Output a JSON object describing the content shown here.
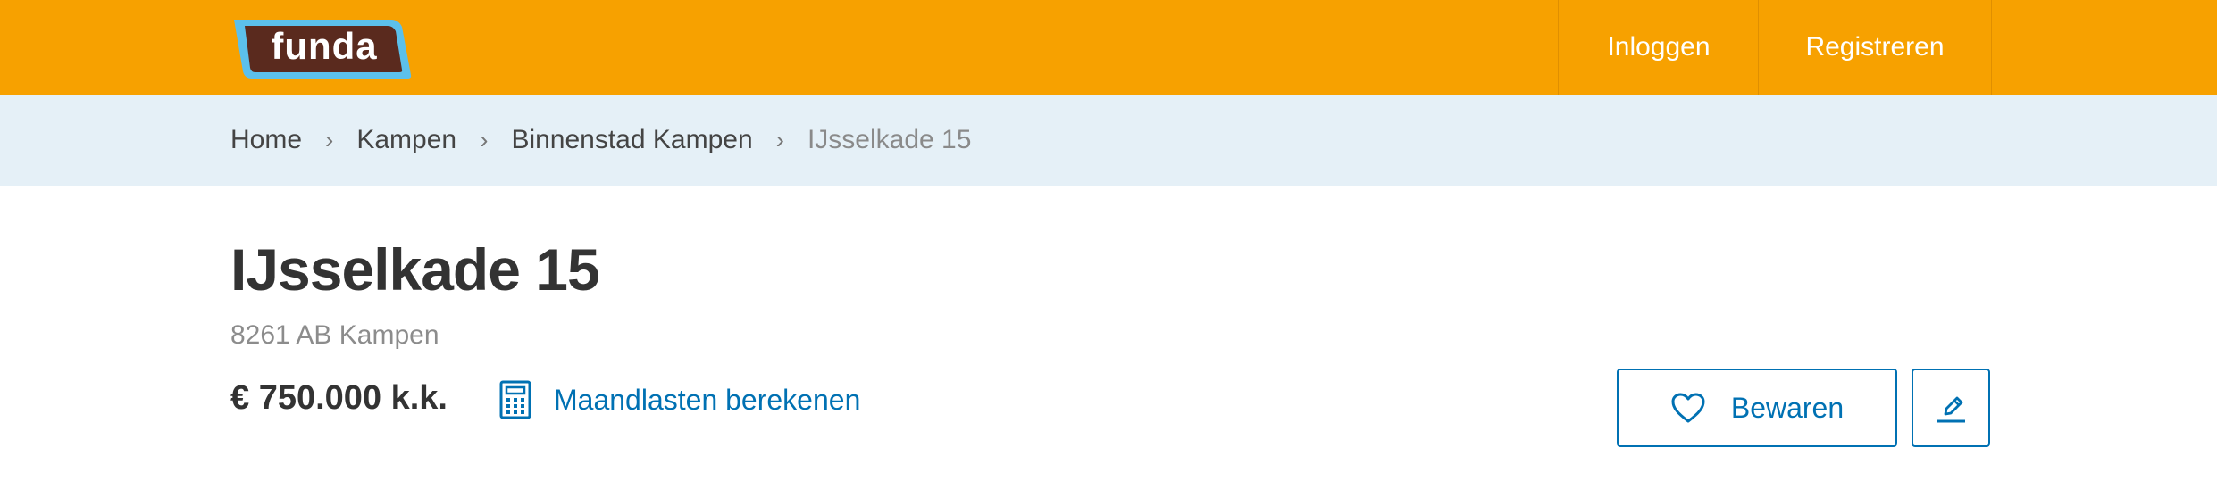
{
  "header": {
    "logo_text": "funda",
    "nav": {
      "login": "Inloggen",
      "register": "Registreren"
    }
  },
  "breadcrumb": {
    "items": [
      "Home",
      "Kampen",
      "Binnenstad Kampen"
    ],
    "current": "IJsselkade 15",
    "separator": "›"
  },
  "listing": {
    "title": "IJsselkade 15",
    "address": "8261 AB Kampen",
    "price": "€ 750.000 k.k.",
    "calc_link": "Maandlasten berekenen",
    "save_button": "Bewaren"
  },
  "icons": {
    "calculator": "calculator-icon",
    "heart": "heart-icon",
    "pencil": "pencil-icon"
  },
  "colors": {
    "brand_orange": "#f7a100",
    "link_blue": "#0071b3",
    "breadcrumb_bg": "#e5f0f7",
    "logo_brown": "#5a2a1e",
    "logo_outline": "#5cc0eb"
  }
}
